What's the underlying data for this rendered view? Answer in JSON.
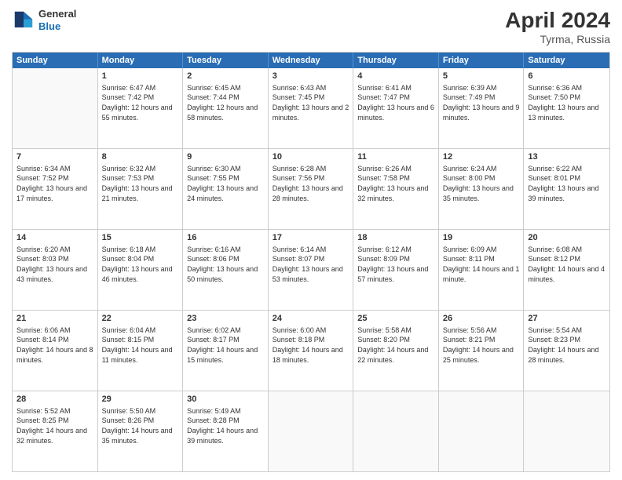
{
  "header": {
    "logo_general": "General",
    "logo_blue": "Blue",
    "month_year": "April 2024",
    "location": "Tyrma, Russia"
  },
  "weekdays": [
    "Sunday",
    "Monday",
    "Tuesday",
    "Wednesday",
    "Thursday",
    "Friday",
    "Saturday"
  ],
  "weeks": [
    [
      {
        "date": "",
        "sunrise": "",
        "sunset": "",
        "daylight": ""
      },
      {
        "date": "1",
        "sunrise": "Sunrise: 6:47 AM",
        "sunset": "Sunset: 7:42 PM",
        "daylight": "Daylight: 12 hours and 55 minutes."
      },
      {
        "date": "2",
        "sunrise": "Sunrise: 6:45 AM",
        "sunset": "Sunset: 7:44 PM",
        "daylight": "Daylight: 12 hours and 58 minutes."
      },
      {
        "date": "3",
        "sunrise": "Sunrise: 6:43 AM",
        "sunset": "Sunset: 7:45 PM",
        "daylight": "Daylight: 13 hours and 2 minutes."
      },
      {
        "date": "4",
        "sunrise": "Sunrise: 6:41 AM",
        "sunset": "Sunset: 7:47 PM",
        "daylight": "Daylight: 13 hours and 6 minutes."
      },
      {
        "date": "5",
        "sunrise": "Sunrise: 6:39 AM",
        "sunset": "Sunset: 7:49 PM",
        "daylight": "Daylight: 13 hours and 9 minutes."
      },
      {
        "date": "6",
        "sunrise": "Sunrise: 6:36 AM",
        "sunset": "Sunset: 7:50 PM",
        "daylight": "Daylight: 13 hours and 13 minutes."
      }
    ],
    [
      {
        "date": "7",
        "sunrise": "Sunrise: 6:34 AM",
        "sunset": "Sunset: 7:52 PM",
        "daylight": "Daylight: 13 hours and 17 minutes."
      },
      {
        "date": "8",
        "sunrise": "Sunrise: 6:32 AM",
        "sunset": "Sunset: 7:53 PM",
        "daylight": "Daylight: 13 hours and 21 minutes."
      },
      {
        "date": "9",
        "sunrise": "Sunrise: 6:30 AM",
        "sunset": "Sunset: 7:55 PM",
        "daylight": "Daylight: 13 hours and 24 minutes."
      },
      {
        "date": "10",
        "sunrise": "Sunrise: 6:28 AM",
        "sunset": "Sunset: 7:56 PM",
        "daylight": "Daylight: 13 hours and 28 minutes."
      },
      {
        "date": "11",
        "sunrise": "Sunrise: 6:26 AM",
        "sunset": "Sunset: 7:58 PM",
        "daylight": "Daylight: 13 hours and 32 minutes."
      },
      {
        "date": "12",
        "sunrise": "Sunrise: 6:24 AM",
        "sunset": "Sunset: 8:00 PM",
        "daylight": "Daylight: 13 hours and 35 minutes."
      },
      {
        "date": "13",
        "sunrise": "Sunrise: 6:22 AM",
        "sunset": "Sunset: 8:01 PM",
        "daylight": "Daylight: 13 hours and 39 minutes."
      }
    ],
    [
      {
        "date": "14",
        "sunrise": "Sunrise: 6:20 AM",
        "sunset": "Sunset: 8:03 PM",
        "daylight": "Daylight: 13 hours and 43 minutes."
      },
      {
        "date": "15",
        "sunrise": "Sunrise: 6:18 AM",
        "sunset": "Sunset: 8:04 PM",
        "daylight": "Daylight: 13 hours and 46 minutes."
      },
      {
        "date": "16",
        "sunrise": "Sunrise: 6:16 AM",
        "sunset": "Sunset: 8:06 PM",
        "daylight": "Daylight: 13 hours and 50 minutes."
      },
      {
        "date": "17",
        "sunrise": "Sunrise: 6:14 AM",
        "sunset": "Sunset: 8:07 PM",
        "daylight": "Daylight: 13 hours and 53 minutes."
      },
      {
        "date": "18",
        "sunrise": "Sunrise: 6:12 AM",
        "sunset": "Sunset: 8:09 PM",
        "daylight": "Daylight: 13 hours and 57 minutes."
      },
      {
        "date": "19",
        "sunrise": "Sunrise: 6:09 AM",
        "sunset": "Sunset: 8:11 PM",
        "daylight": "Daylight: 14 hours and 1 minute."
      },
      {
        "date": "20",
        "sunrise": "Sunrise: 6:08 AM",
        "sunset": "Sunset: 8:12 PM",
        "daylight": "Daylight: 14 hours and 4 minutes."
      }
    ],
    [
      {
        "date": "21",
        "sunrise": "Sunrise: 6:06 AM",
        "sunset": "Sunset: 8:14 PM",
        "daylight": "Daylight: 14 hours and 8 minutes."
      },
      {
        "date": "22",
        "sunrise": "Sunrise: 6:04 AM",
        "sunset": "Sunset: 8:15 PM",
        "daylight": "Daylight: 14 hours and 11 minutes."
      },
      {
        "date": "23",
        "sunrise": "Sunrise: 6:02 AM",
        "sunset": "Sunset: 8:17 PM",
        "daylight": "Daylight: 14 hours and 15 minutes."
      },
      {
        "date": "24",
        "sunrise": "Sunrise: 6:00 AM",
        "sunset": "Sunset: 8:18 PM",
        "daylight": "Daylight: 14 hours and 18 minutes."
      },
      {
        "date": "25",
        "sunrise": "Sunrise: 5:58 AM",
        "sunset": "Sunset: 8:20 PM",
        "daylight": "Daylight: 14 hours and 22 minutes."
      },
      {
        "date": "26",
        "sunrise": "Sunrise: 5:56 AM",
        "sunset": "Sunset: 8:21 PM",
        "daylight": "Daylight: 14 hours and 25 minutes."
      },
      {
        "date": "27",
        "sunrise": "Sunrise: 5:54 AM",
        "sunset": "Sunset: 8:23 PM",
        "daylight": "Daylight: 14 hours and 28 minutes."
      }
    ],
    [
      {
        "date": "28",
        "sunrise": "Sunrise: 5:52 AM",
        "sunset": "Sunset: 8:25 PM",
        "daylight": "Daylight: 14 hours and 32 minutes."
      },
      {
        "date": "29",
        "sunrise": "Sunrise: 5:50 AM",
        "sunset": "Sunset: 8:26 PM",
        "daylight": "Daylight: 14 hours and 35 minutes."
      },
      {
        "date": "30",
        "sunrise": "Sunrise: 5:49 AM",
        "sunset": "Sunset: 8:28 PM",
        "daylight": "Daylight: 14 hours and 39 minutes."
      },
      {
        "date": "",
        "sunrise": "",
        "sunset": "",
        "daylight": ""
      },
      {
        "date": "",
        "sunrise": "",
        "sunset": "",
        "daylight": ""
      },
      {
        "date": "",
        "sunrise": "",
        "sunset": "",
        "daylight": ""
      },
      {
        "date": "",
        "sunrise": "",
        "sunset": "",
        "daylight": ""
      }
    ]
  ]
}
